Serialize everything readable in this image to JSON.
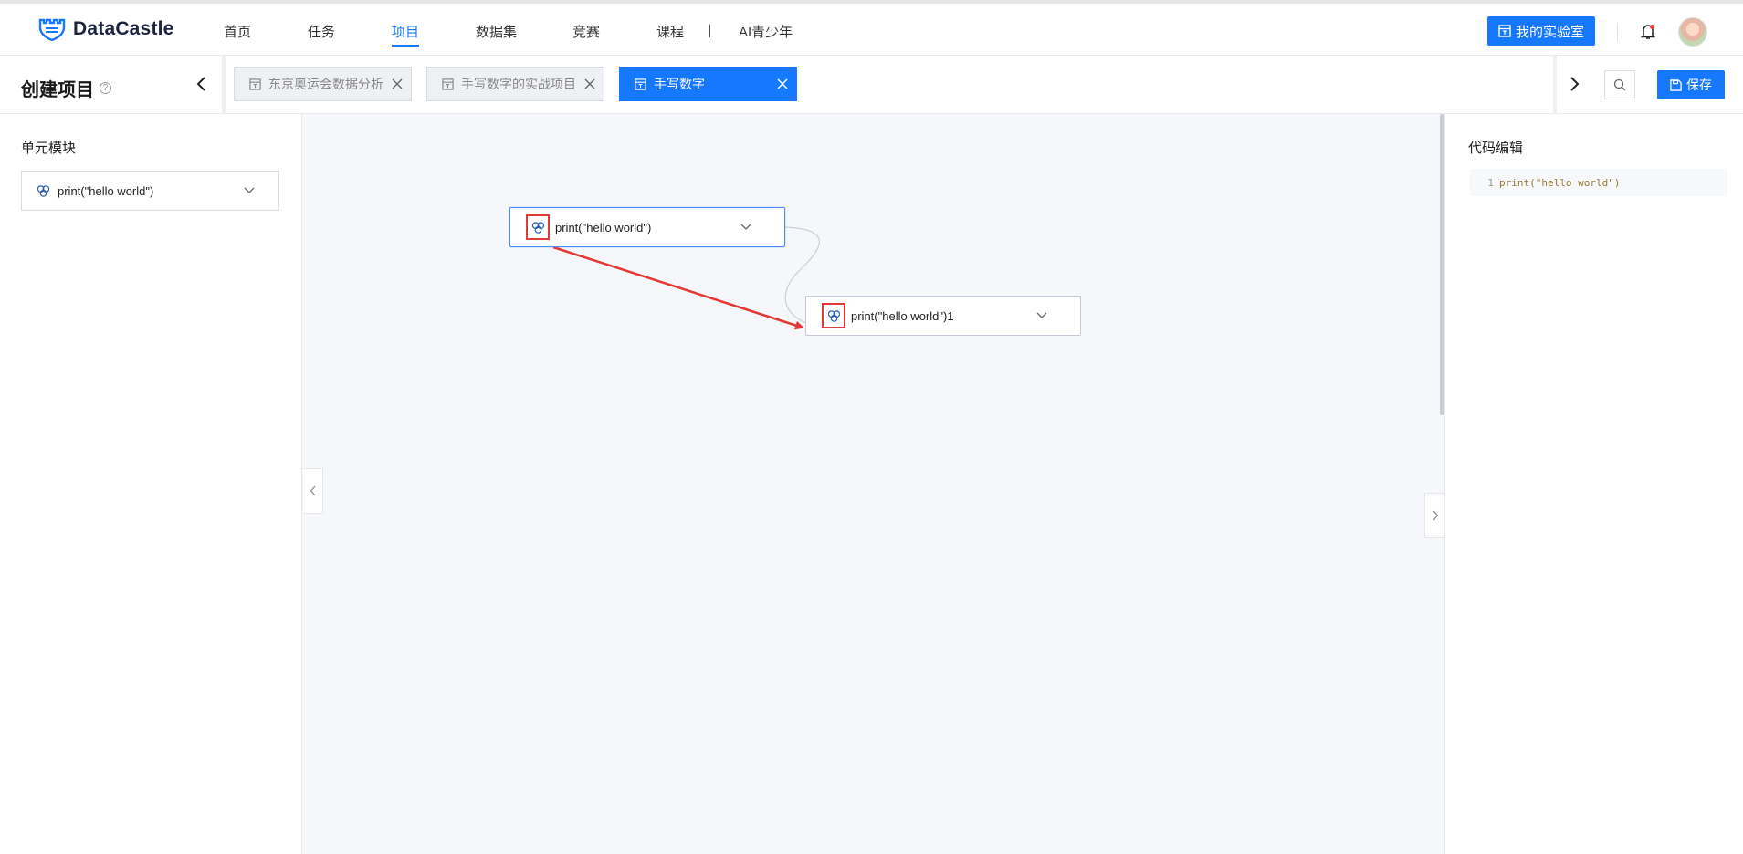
{
  "brand": {
    "name": "DataCastle"
  },
  "nav": {
    "items": [
      {
        "label": "首页",
        "active": false
      },
      {
        "label": "任务",
        "active": false
      },
      {
        "label": "项目",
        "active": true
      },
      {
        "label": "数据集",
        "active": false
      },
      {
        "label": "竞赛",
        "active": false
      },
      {
        "label": "课程",
        "active": false
      },
      {
        "label": "AI青少年",
        "active": false
      }
    ],
    "lab_button": "我的实验室"
  },
  "toolbar": {
    "title": "创建项目",
    "tabs": [
      {
        "label": "东京奥运会数据分析",
        "active": false
      },
      {
        "label": "手写数字的实战项目",
        "active": false
      },
      {
        "label": "手写数字",
        "active": true
      }
    ],
    "save_label": "保存"
  },
  "left_panel": {
    "heading": "单元模块",
    "modules": [
      {
        "label": "print(\"hello world\")"
      }
    ]
  },
  "canvas": {
    "nodes": [
      {
        "label": "print(\"hello world\")",
        "selected": true
      },
      {
        "label": "print(\"hello world\")1",
        "selected": false
      }
    ]
  },
  "right_panel": {
    "heading": "代码编辑",
    "code_lines": [
      {
        "num": "1",
        "text": "print(\"hello world\")"
      }
    ]
  },
  "colors": {
    "primary": "#1677ff",
    "annotation": "#e53935"
  }
}
